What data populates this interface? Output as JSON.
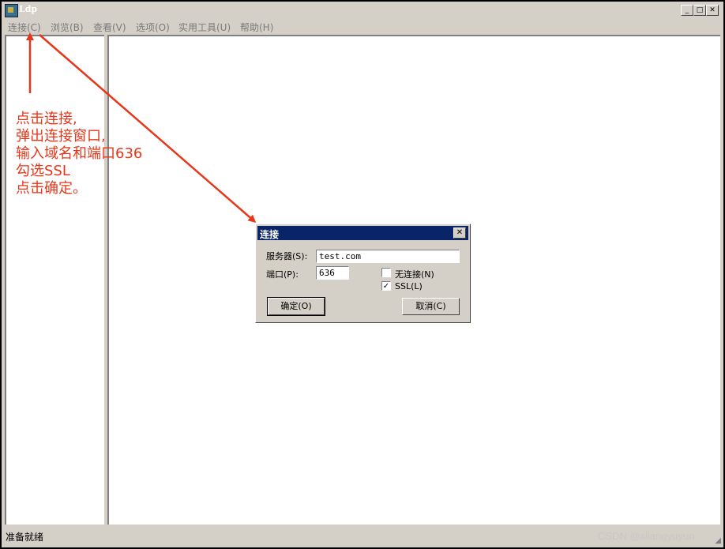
{
  "window": {
    "title": "Ldp",
    "minimize_label": "_",
    "maximize_label": "□",
    "close_label": "✕"
  },
  "menubar": {
    "items": [
      "连接(C)",
      "浏览(B)",
      "查看(V)",
      "选项(O)",
      "实用工具(U)",
      "帮助(H)"
    ]
  },
  "statusbar": {
    "text": "准备就绪",
    "watermark": "CSDN @xilangyuyun"
  },
  "annotation": {
    "lines": [
      "点击连接,",
      "弹出连接窗口,",
      "输入域名和端口636",
      "勾选SSL",
      "点击确定。"
    ],
    "color": "#e8361a"
  },
  "dialog": {
    "title": "连接",
    "close_label": "✕",
    "server_label": "服务器(S):",
    "server_value": "test.com",
    "port_label": "端口(P):",
    "port_value": "636",
    "connectionless_label": "无连接(N)",
    "connectionless_checked": false,
    "ssl_label": "SSL(L)",
    "ssl_checked": true,
    "ok_label": "确定(O)",
    "cancel_label": "取消(C)"
  }
}
